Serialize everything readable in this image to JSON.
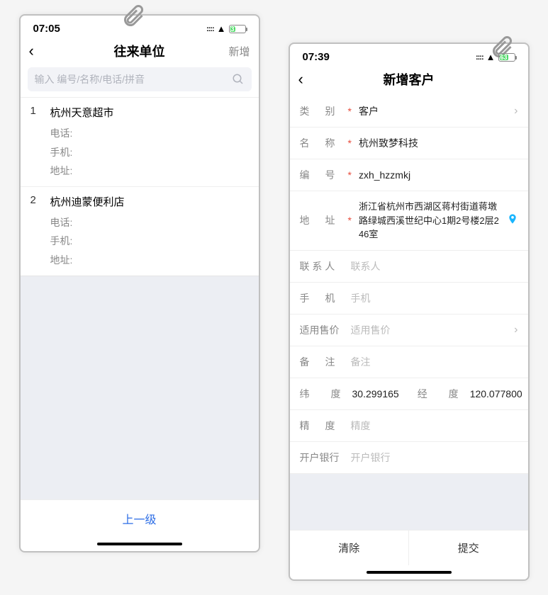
{
  "left": {
    "status": {
      "time": "07:05",
      "battery_pct": "37",
      "battery_fill_pct": 37
    },
    "nav": {
      "title": "往来单位",
      "action": "新增"
    },
    "search": {
      "placeholder": "输入 编号/名称/电话/拼音"
    },
    "list": [
      {
        "idx": "1",
        "name": "杭州天意超市",
        "tel_label": "电话:",
        "mobile_label": "手机:",
        "addr_label": "地址:"
      },
      {
        "idx": "2",
        "name": "杭州迪蒙便利店",
        "tel_label": "电话:",
        "mobile_label": "手机:",
        "addr_label": "地址:"
      }
    ],
    "footer": {
      "label": "上一级"
    }
  },
  "right": {
    "status": {
      "time": "07:39",
      "battery_pct": "63",
      "battery_fill_pct": 63
    },
    "nav": {
      "title": "新增客户"
    },
    "form": {
      "type_label": "类　别",
      "type_value": "客户",
      "name_label": "名　称",
      "name_value": "杭州致梦科技",
      "code_label": "编　号",
      "code_value": "zxh_hzzmkj",
      "addr_label": "地　址",
      "addr_value": "浙江省杭州市西湖区蒋村街道蒋墩路绿城西溪世纪中心1期2号楼2层246室",
      "contact_label": "联 系 人",
      "contact_placeholder": "联系人",
      "mobile_label": "手　机",
      "mobile_placeholder": "手机",
      "price_label": "适用售价",
      "price_placeholder": "适用售价",
      "remark_label": "备　注",
      "remark_placeholder": "备注",
      "lat_label": "纬　度",
      "lat_value": "30.299165",
      "lng_label": "经　度",
      "lng_value": "120.077800",
      "precision_label": "精　度",
      "precision_placeholder": "精度",
      "bank_label": "开户银行",
      "bank_placeholder": "开户银行"
    },
    "buttons": {
      "clear": "清除",
      "submit": "提交"
    }
  }
}
